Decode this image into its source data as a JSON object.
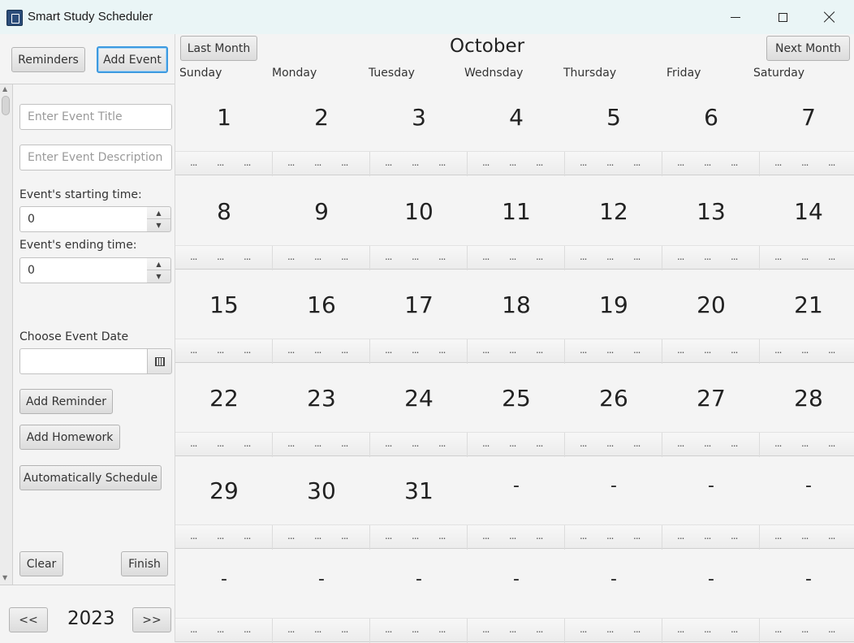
{
  "window": {
    "title": "Smart Study Scheduler"
  },
  "left": {
    "reminders_label": "Reminders",
    "add_event_label": "Add Event",
    "title_placeholder": "Enter Event Title",
    "description_placeholder": "Enter Event Description",
    "start_label": "Event's starting time:",
    "start_value": "0",
    "end_label": "Event's ending time:",
    "end_value": "0",
    "date_label": "Choose Event Date",
    "date_value": "",
    "add_reminder_label": "Add Reminder",
    "add_homework_label": "Add Homework",
    "auto_schedule_label": "Automatically Schedule",
    "clear_label": "Clear",
    "finish_label": "Finish",
    "prev_year_label": "<<",
    "year": "2023",
    "next_year_label": ">>"
  },
  "calendar": {
    "last_month_label": "Last Month",
    "month": "October",
    "next_month_label": "Next Month",
    "weekdays": [
      "Sunday",
      "Monday",
      "Tuesday",
      "Wednsday",
      "Thursday",
      "Friday",
      "Saturday"
    ],
    "weeks": [
      [
        "1",
        "2",
        "3",
        "4",
        "5",
        "6",
        "7"
      ],
      [
        "8",
        "9",
        "10",
        "11",
        "12",
        "13",
        "14"
      ],
      [
        "15",
        "16",
        "17",
        "18",
        "19",
        "20",
        "21"
      ],
      [
        "22",
        "23",
        "24",
        "25",
        "26",
        "27",
        "28"
      ],
      [
        "29",
        "30",
        "31",
        "-",
        "-",
        "-",
        "-"
      ],
      [
        "-",
        "-",
        "-",
        "-",
        "-",
        "-",
        "-"
      ]
    ],
    "slot_placeholder": "..."
  },
  "icons": {
    "app": "app-icon",
    "minimize": "minimize-icon",
    "maximize": "maximize-icon",
    "close": "close-icon",
    "calendar": "calendar-icon"
  }
}
